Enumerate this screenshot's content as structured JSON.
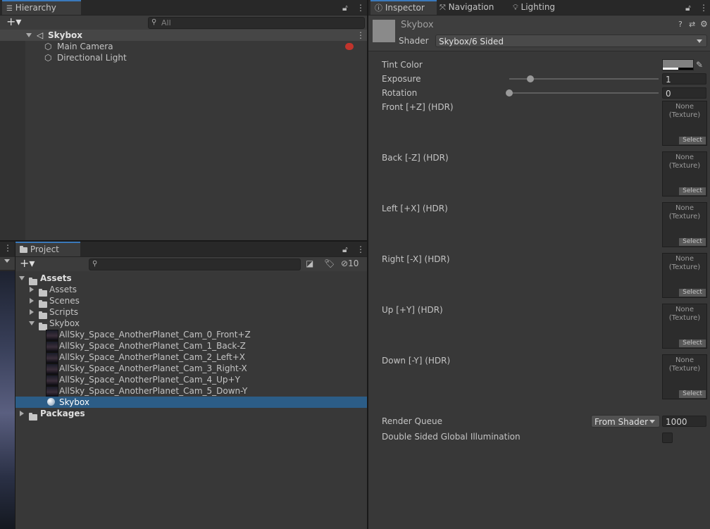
{
  "hierarchy": {
    "tab_label": "Hierarchy",
    "search_placeholder": "All",
    "items": [
      {
        "label": "Skybox"
      },
      {
        "label": "Main Camera"
      },
      {
        "label": "Directional Light"
      }
    ]
  },
  "project": {
    "tab_label": "Project",
    "search_placeholder": "",
    "hidden_count": "10",
    "tree": {
      "assets": "Assets",
      "assets_sub": "Assets",
      "scenes": "Scenes",
      "scripts": "Scripts",
      "skybox": "Skybox",
      "files": [
        "AllSky_Space_AnotherPlanet_Cam_0_Front+Z",
        "AllSky_Space_AnotherPlanet_Cam_1_Back-Z",
        "AllSky_Space_AnotherPlanet_Cam_2_Left+X",
        "AllSky_Space_AnotherPlanet_Cam_3_Right-X",
        "AllSky_Space_AnotherPlanet_Cam_4_Up+Y",
        "AllSky_Space_AnotherPlanet_Cam_5_Down-Y"
      ],
      "material": "Skybox",
      "packages": "Packages"
    }
  },
  "inspector": {
    "tabs": [
      {
        "label": "Inspector",
        "icon": "info-icon"
      },
      {
        "label": "Navigation",
        "icon": "navigation-icon"
      },
      {
        "label": "Lighting",
        "icon": "lightbulb-icon"
      }
    ],
    "material_name": "Skybox",
    "shader_label": "Shader",
    "shader_value": "Skybox/6 Sided",
    "properties": {
      "tint_color": "Tint Color",
      "exposure": "Exposure",
      "exposure_value": "1",
      "exposure_level": 0.14,
      "rotation": "Rotation",
      "rotation_value": "0",
      "rotation_level": 0.0
    },
    "textures": [
      {
        "label": "Front [+Z]   (HDR)"
      },
      {
        "label": "Back [-Z]   (HDR)"
      },
      {
        "label": "Left [+X]   (HDR)"
      },
      {
        "label": "Right [-X]   (HDR)"
      },
      {
        "label": "Up [+Y]   (HDR)"
      },
      {
        "label": "Down [-Y]   (HDR)"
      }
    ],
    "texture_none": "None",
    "texture_type": "(Texture)",
    "texture_select": "Select",
    "render_queue_label": "Render Queue",
    "render_queue_mode": "From Shader",
    "render_queue_value": "1000",
    "double_sided_label": "Double Sided Global Illumination"
  },
  "colors": {
    "selection": "#2c5d87",
    "tab_accent": "#3a79bb",
    "panel_bg": "#383838"
  }
}
